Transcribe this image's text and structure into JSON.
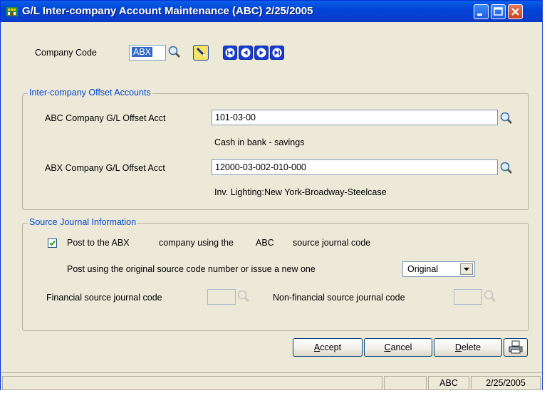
{
  "window": {
    "title": "G/L Inter-company Account Maintenance (ABC) 2/25/2005"
  },
  "header": {
    "company_code_label": "Company Code",
    "company_code_value": "ABX"
  },
  "offset_group": {
    "title": "Inter-company Offset Accounts",
    "abc_label": "ABC  Company G/L Offset Acct",
    "abc_value": "101-03-00",
    "abc_desc": "Cash in bank - savings",
    "abx_label": "ABX  Company G/L Offset Acct",
    "abx_value": "12000-03-002-010-000",
    "abx_desc": "Inv. Lighting:New York-Broadway-Steelcase"
  },
  "journal_group": {
    "title": "Source Journal Information",
    "post_checkbox_checked": true,
    "post_text_a": "Post to the ABX",
    "post_text_b": "company using the",
    "post_text_c": "ABC",
    "post_text_d": "source journal code",
    "post_using_label": "Post using the original source code number or issue a new one",
    "post_using_selected": "Original",
    "financial_label": "Financial source journal code",
    "financial_value": "",
    "nonfinancial_label": "Non-financial source journal code",
    "nonfinancial_value": ""
  },
  "buttons": {
    "accept_u": "A",
    "accept_rest": "ccept",
    "cancel_u": "C",
    "cancel_rest": "ancel",
    "delete_u": "D",
    "delete_rest": "elete"
  },
  "statusbar": {
    "company": "ABC",
    "date": "2/25/2005"
  },
  "icons": [
    "app-icon",
    "lookup-icon",
    "wand-icon",
    "first-record-icon",
    "previous-record-icon",
    "next-record-icon",
    "last-record-icon",
    "printer-icon",
    "minimize-icon",
    "maximize-icon",
    "close-icon",
    "checkmark-icon",
    "dropdown-arrow-icon"
  ]
}
